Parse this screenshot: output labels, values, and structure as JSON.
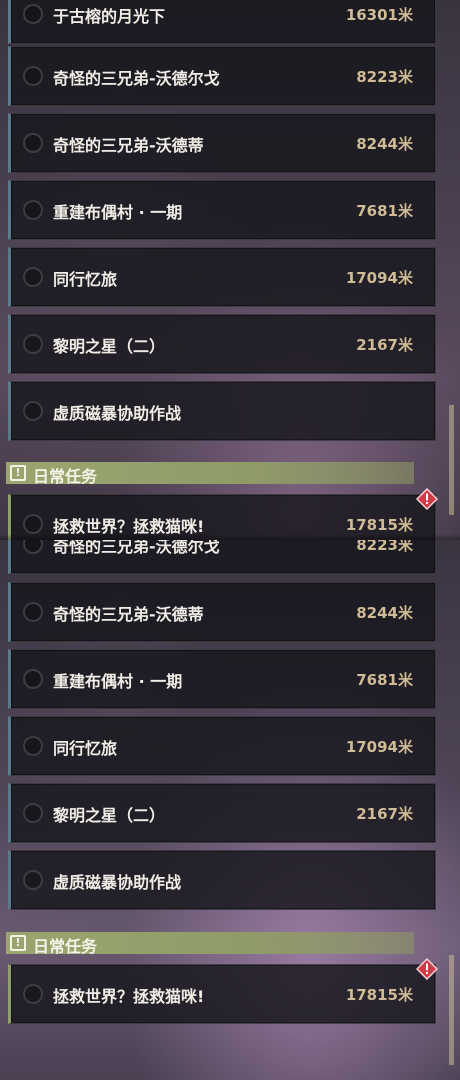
{
  "top_panel": {
    "quests": [
      {
        "title": "于古榕的月光下",
        "distance": "16301米"
      },
      {
        "title": "奇怪的三兄弟-沃德尔戈",
        "distance": "8223米"
      },
      {
        "title": "奇怪的三兄弟-沃德蒂",
        "distance": "8244米"
      },
      {
        "title": "重建布偶村 · 一期",
        "distance": "7681米"
      },
      {
        "title": "同行忆旅",
        "distance": "17094米"
      },
      {
        "title": "黎明之星（二）",
        "distance": "2167米"
      },
      {
        "title": "虚质磁暴协助作战",
        "distance": ""
      }
    ],
    "section_title": "日常任务",
    "daily": {
      "title": "拯救世界？拯救猫咪!",
      "distance": "17815米"
    }
  },
  "bottom_panel": {
    "quests": [
      {
        "title": "奇怪的三兄弟-沃德尔戈",
        "distance": "8223米"
      },
      {
        "title": "奇怪的三兄弟-沃德蒂",
        "distance": "8244米"
      },
      {
        "title": "重建布偶村 · 一期",
        "distance": "7681米"
      },
      {
        "title": "同行忆旅",
        "distance": "17094米"
      },
      {
        "title": "黎明之星（二）",
        "distance": "2167米"
      },
      {
        "title": "虚质磁暴协助作战",
        "distance": ""
      }
    ],
    "section_title": "日常任务",
    "daily": {
      "title": "拯救世界？拯救猫咪!",
      "distance": "17815米"
    }
  },
  "icons": {
    "section_badge": "exclamation-box-icon",
    "alert": "red-diamond-alert-icon",
    "radio": "empty-circle-icon"
  },
  "colors": {
    "title_text": "#f1ede6",
    "distance_text": "#cfbb95",
    "section_bar": "#9aa56f",
    "alert_red": "#d23a4a"
  }
}
